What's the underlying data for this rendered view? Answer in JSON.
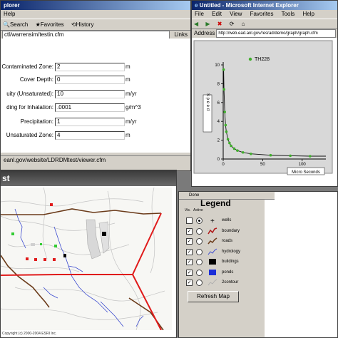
{
  "form_window": {
    "title": "plorer",
    "menu": [
      "Help"
    ],
    "toolbar": [
      "Search",
      "Favorites",
      "History"
    ],
    "links_label": "Links",
    "address": "ctl/warrensim/testin.cfm",
    "fields": [
      {
        "label": "Contaminated Zone:",
        "value": "2",
        "unit": "m"
      },
      {
        "label": "Cover Depth:",
        "value": "0",
        "unit": "m"
      },
      {
        "label": "uity (Unsaturated):",
        "value": "10",
        "unit": "m/yr"
      },
      {
        "label": "ding for Inhalation:",
        "value": ".0001",
        "unit": "g/m^3"
      },
      {
        "label": "Precipitation:",
        "value": "1",
        "unit": "m/yr"
      },
      {
        "label": "Unsaturated Zone:",
        "value": "4",
        "unit": "m"
      }
    ],
    "status_url": "eanl.gov/website/LDRDMtest/viewer.cfm"
  },
  "graph_window": {
    "title": "Untitled - Microsoft Internet Explorer",
    "menu": [
      "File",
      "Edit",
      "View",
      "Favorites",
      "Tools",
      "Help"
    ],
    "address_label": "Address",
    "address": "http://web.ead.anl.gov/resrad/demo/graph/graph.cfm"
  },
  "chart_data": {
    "type": "scatter",
    "ylabel": "S p e e d",
    "xlabel": "Micro Seconds",
    "legend": "TH228",
    "legend_position": "top-right",
    "grid": false,
    "xlim": [
      0,
      130
    ],
    "ylim": [
      0,
      10
    ],
    "yticks": [
      "10",
      "8",
      "6",
      "4",
      "2",
      "0"
    ],
    "xticks": [
      "0",
      "50",
      "100"
    ],
    "x": [
      0.5,
      1,
      2,
      3,
      4,
      6,
      8,
      10,
      14,
      18,
      25,
      35,
      60,
      85,
      110
    ],
    "y": [
      9.5,
      7.4,
      5.0,
      3.6,
      2.9,
      2.1,
      1.7,
      1.4,
      1.1,
      0.9,
      0.7,
      0.55,
      0.4,
      0.35,
      0.3
    ],
    "color": "#3fae2c"
  },
  "map_window": {
    "title_fragment": "st",
    "copyright": "Copyright (c) 2000-2004 ESRI Inc.",
    "mode_label": "Done",
    "legend_title": "Legend",
    "col_vis": "Vis.",
    "col_active": "Active",
    "layers": [
      {
        "name": "wells",
        "visible": false,
        "active": true,
        "symbol": "cross"
      },
      {
        "name": "boundary",
        "visible": true,
        "active": false,
        "symbol": "boundary"
      },
      {
        "name": "roads",
        "visible": true,
        "active": false,
        "symbol": "roads"
      },
      {
        "name": "hydrology",
        "visible": true,
        "active": false,
        "symbol": "hydro"
      },
      {
        "name": "buildings",
        "visible": true,
        "active": false,
        "symbol": "black-square"
      },
      {
        "name": "ponds",
        "visible": true,
        "active": false,
        "symbol": "blue-square"
      },
      {
        "name": "2contour",
        "visible": true,
        "active": false,
        "symbol": "contour"
      }
    ],
    "refresh_button": "Refresh Map"
  }
}
